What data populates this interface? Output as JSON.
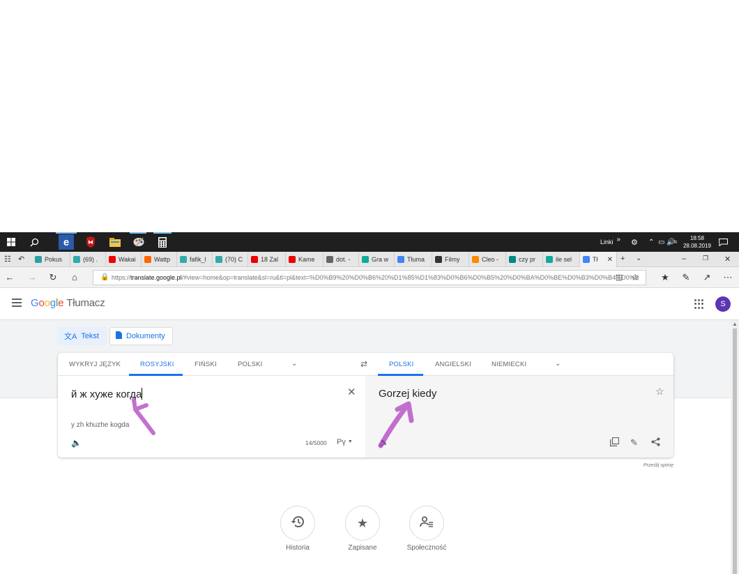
{
  "taskbar": {
    "links_label": "Linki",
    "time": "18:58",
    "date": "28.08.2019"
  },
  "tabs": [
    {
      "label": "Pokus",
      "color": "#2ea0a0"
    },
    {
      "label": "(69) .",
      "color": "#3aa"
    },
    {
      "label": "Wakai",
      "color": "#e00"
    },
    {
      "label": "Wattp",
      "color": "#f60"
    },
    {
      "label": "fafik_l",
      "color": "#3aa"
    },
    {
      "label": "(70) C",
      "color": "#3aa"
    },
    {
      "label": "18 Zal",
      "color": "#e00"
    },
    {
      "label": "Kame",
      "color": "#e00"
    },
    {
      "label": "dot. -",
      "color": "#666"
    },
    {
      "label": "Gra w",
      "color": "#1a9"
    },
    {
      "label": "Tłuma",
      "color": "#4285f4"
    },
    {
      "label": "Filmy",
      "color": "#333"
    },
    {
      "label": "Cleo -",
      "color": "#f80"
    },
    {
      "label": "czy pr",
      "color": "#088"
    },
    {
      "label": "ile sel",
      "color": "#1a9"
    },
    {
      "label": "Tł",
      "color": "#4285f4"
    }
  ],
  "browser": {
    "url_host": "translate.google.pl",
    "url_prefix": "https://",
    "url_rest": "/#view=home&op=translate&sl=ru&tl=pl&text=%D0%B9%20%D0%B6%20%D1%85%D1%83%D0%B6%D0%B5%20%D0%BA%D0%BE%D0%B3%D0%B4%D0%B"
  },
  "header": {
    "logo": [
      "G",
      "o",
      "o",
      "g",
      "l",
      "e"
    ],
    "product": "Tłumacz",
    "avatar_letter": "S"
  },
  "modes": {
    "text": "Tekst",
    "documents": "Dokumenty"
  },
  "source_langs": [
    "WYKRYJ JĘZYK",
    "ROSYJSKI",
    "FIŃSKI",
    "POLSKI"
  ],
  "target_langs": [
    "POLSKI",
    "ANGIELSKI",
    "NIEMIECKI"
  ],
  "source": {
    "text": "й ж хуже когда",
    "transliteration": "y zh khuzhe kogda",
    "char_count": "14/5000",
    "keyboard": "Рү"
  },
  "target": {
    "text": "Gorzej kiedy"
  },
  "feedback": "Prześlij opinię",
  "bottom": {
    "history": "Historia",
    "saved": "Zapisane",
    "community": "Społeczność"
  },
  "colors": {
    "accent": "#1a73e8",
    "annotation": "#b040c0"
  }
}
